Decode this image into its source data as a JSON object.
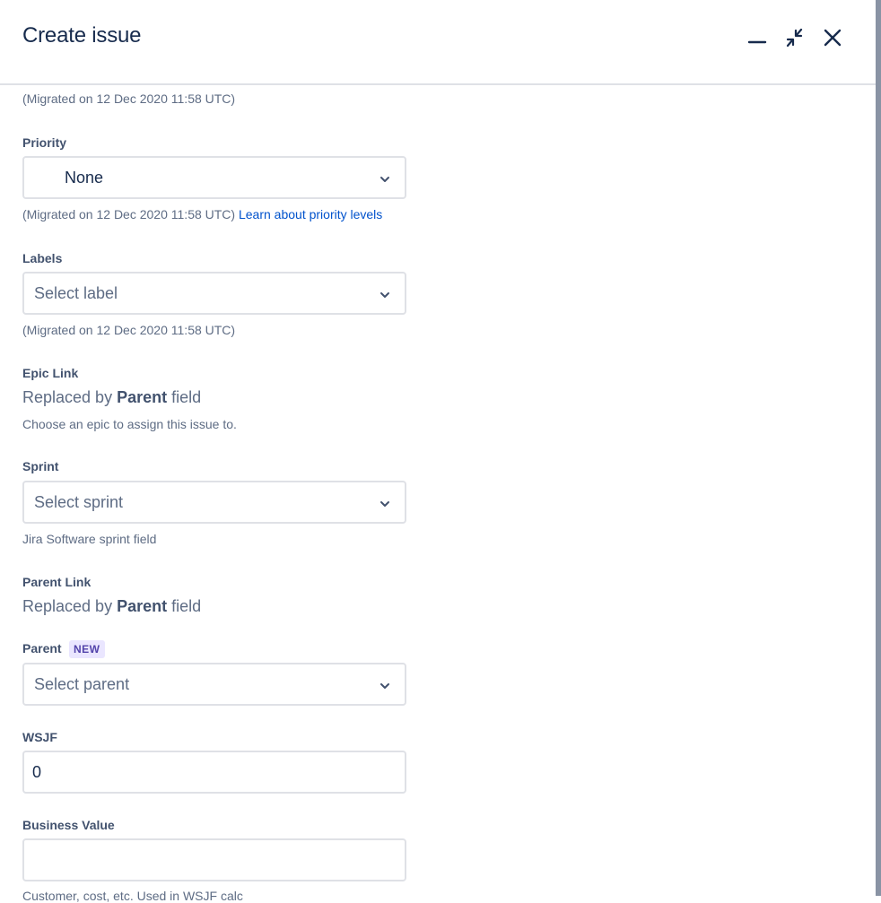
{
  "dialog": {
    "title": "Create issue",
    "icons": {
      "minimize": "minimize-icon",
      "collapse": "collapse-icon",
      "close": "close-icon"
    }
  },
  "fields": {
    "top_help": "(Migrated on 12 Dec 2020 11:58 UTC)",
    "priority": {
      "label": "Priority",
      "value": "None",
      "help": "(Migrated on 12 Dec 2020 11:58 UTC)",
      "help_link": "Learn about priority levels"
    },
    "labels": {
      "label": "Labels",
      "placeholder": "Select label",
      "help": "(Migrated on 12 Dec 2020 11:58 UTC)"
    },
    "epic_link": {
      "label": "Epic Link",
      "replaced_prefix": "Replaced by",
      "replaced_bold": "Parent",
      "replaced_suffix": "field",
      "help": "Choose an epic to assign this issue to."
    },
    "sprint": {
      "label": "Sprint",
      "placeholder": "Select sprint",
      "help": "Jira Software sprint field"
    },
    "parent_link": {
      "label": "Parent Link",
      "replaced_prefix": "Replaced by",
      "replaced_bold": "Parent",
      "replaced_suffix": "field"
    },
    "parent": {
      "label": "Parent",
      "badge": "NEW",
      "placeholder": "Select parent"
    },
    "wsjf": {
      "label": "WSJF",
      "value": "0"
    },
    "business_value": {
      "label": "Business Value",
      "value": "",
      "help": "Customer, cost, etc. Used in WSJF calc"
    }
  },
  "colors": {
    "title": "#172b4d",
    "link": "#0052cc",
    "border": "#dfe1e6",
    "badge_bg": "#eae6ff",
    "badge_text": "#5243aa"
  }
}
